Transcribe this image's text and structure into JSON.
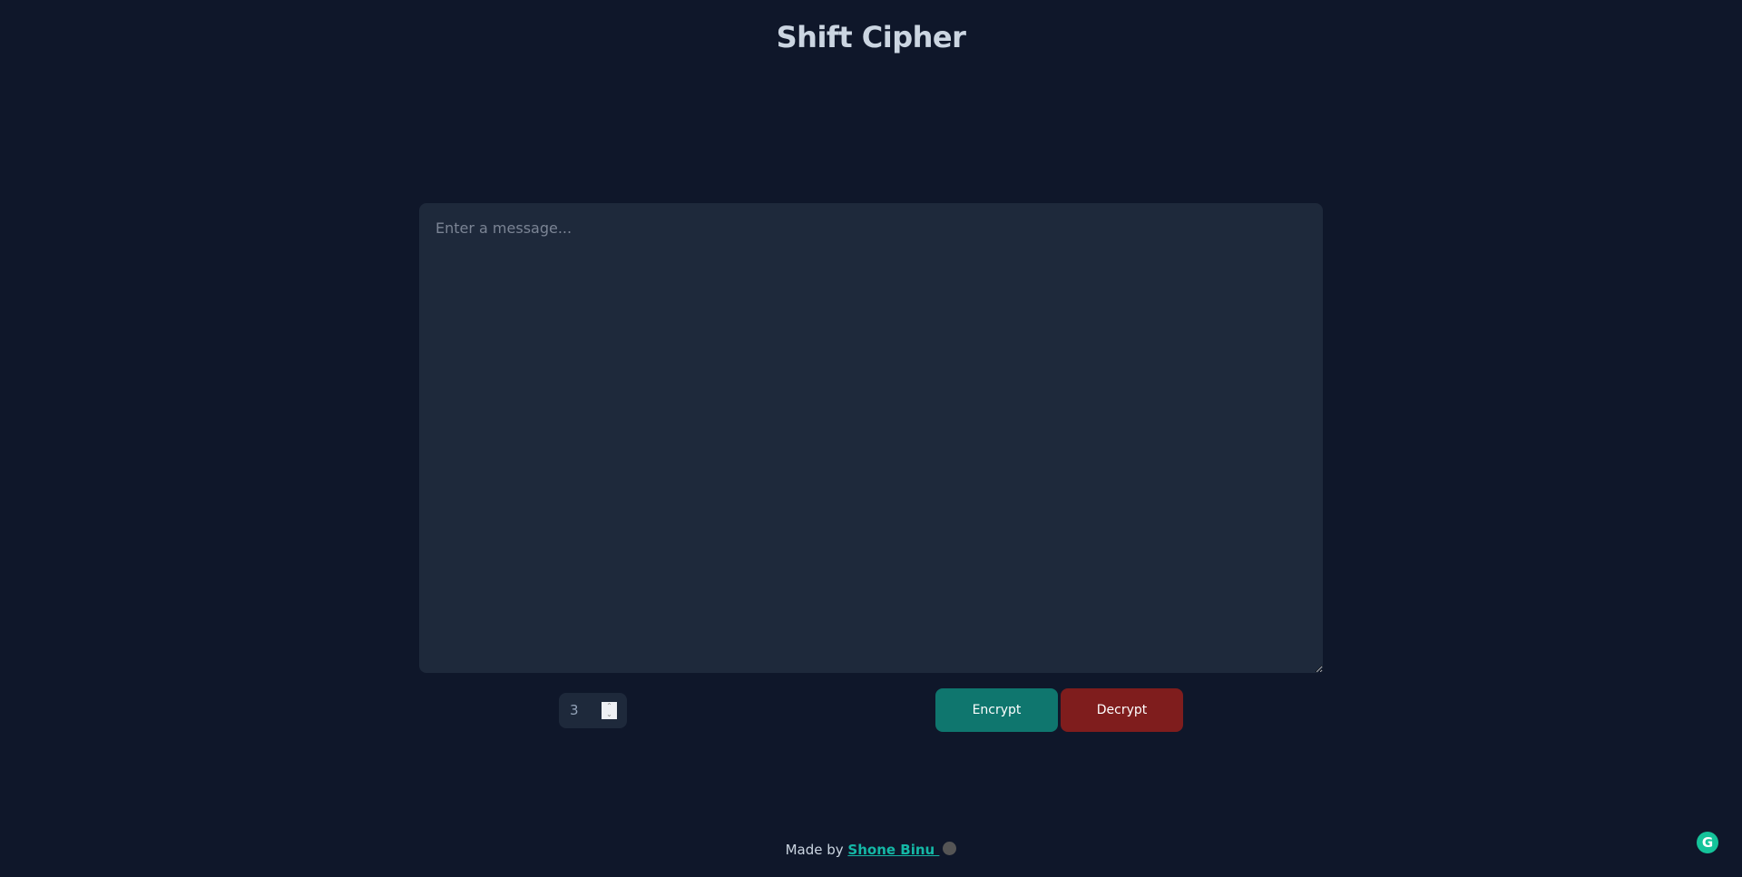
{
  "header": {
    "title": "Shift Cipher"
  },
  "message": {
    "placeholder": "Enter a message...",
    "value": ""
  },
  "shift": {
    "value": "3",
    "spin_up": "^",
    "spin_down": "v"
  },
  "actions": {
    "encrypt_label": "Encrypt",
    "decrypt_label": "Decrypt"
  },
  "footer": {
    "prefix": "Made by ",
    "author": "Shone Binu "
  },
  "icons": {
    "grammarly": "grammarly-icon",
    "github": "github-icon"
  },
  "colors": {
    "background": "#0f172a",
    "panel": "#1e293b",
    "encrypt": "#0f766e",
    "decrypt": "#7f1d1d",
    "link": "#14b8a6"
  }
}
